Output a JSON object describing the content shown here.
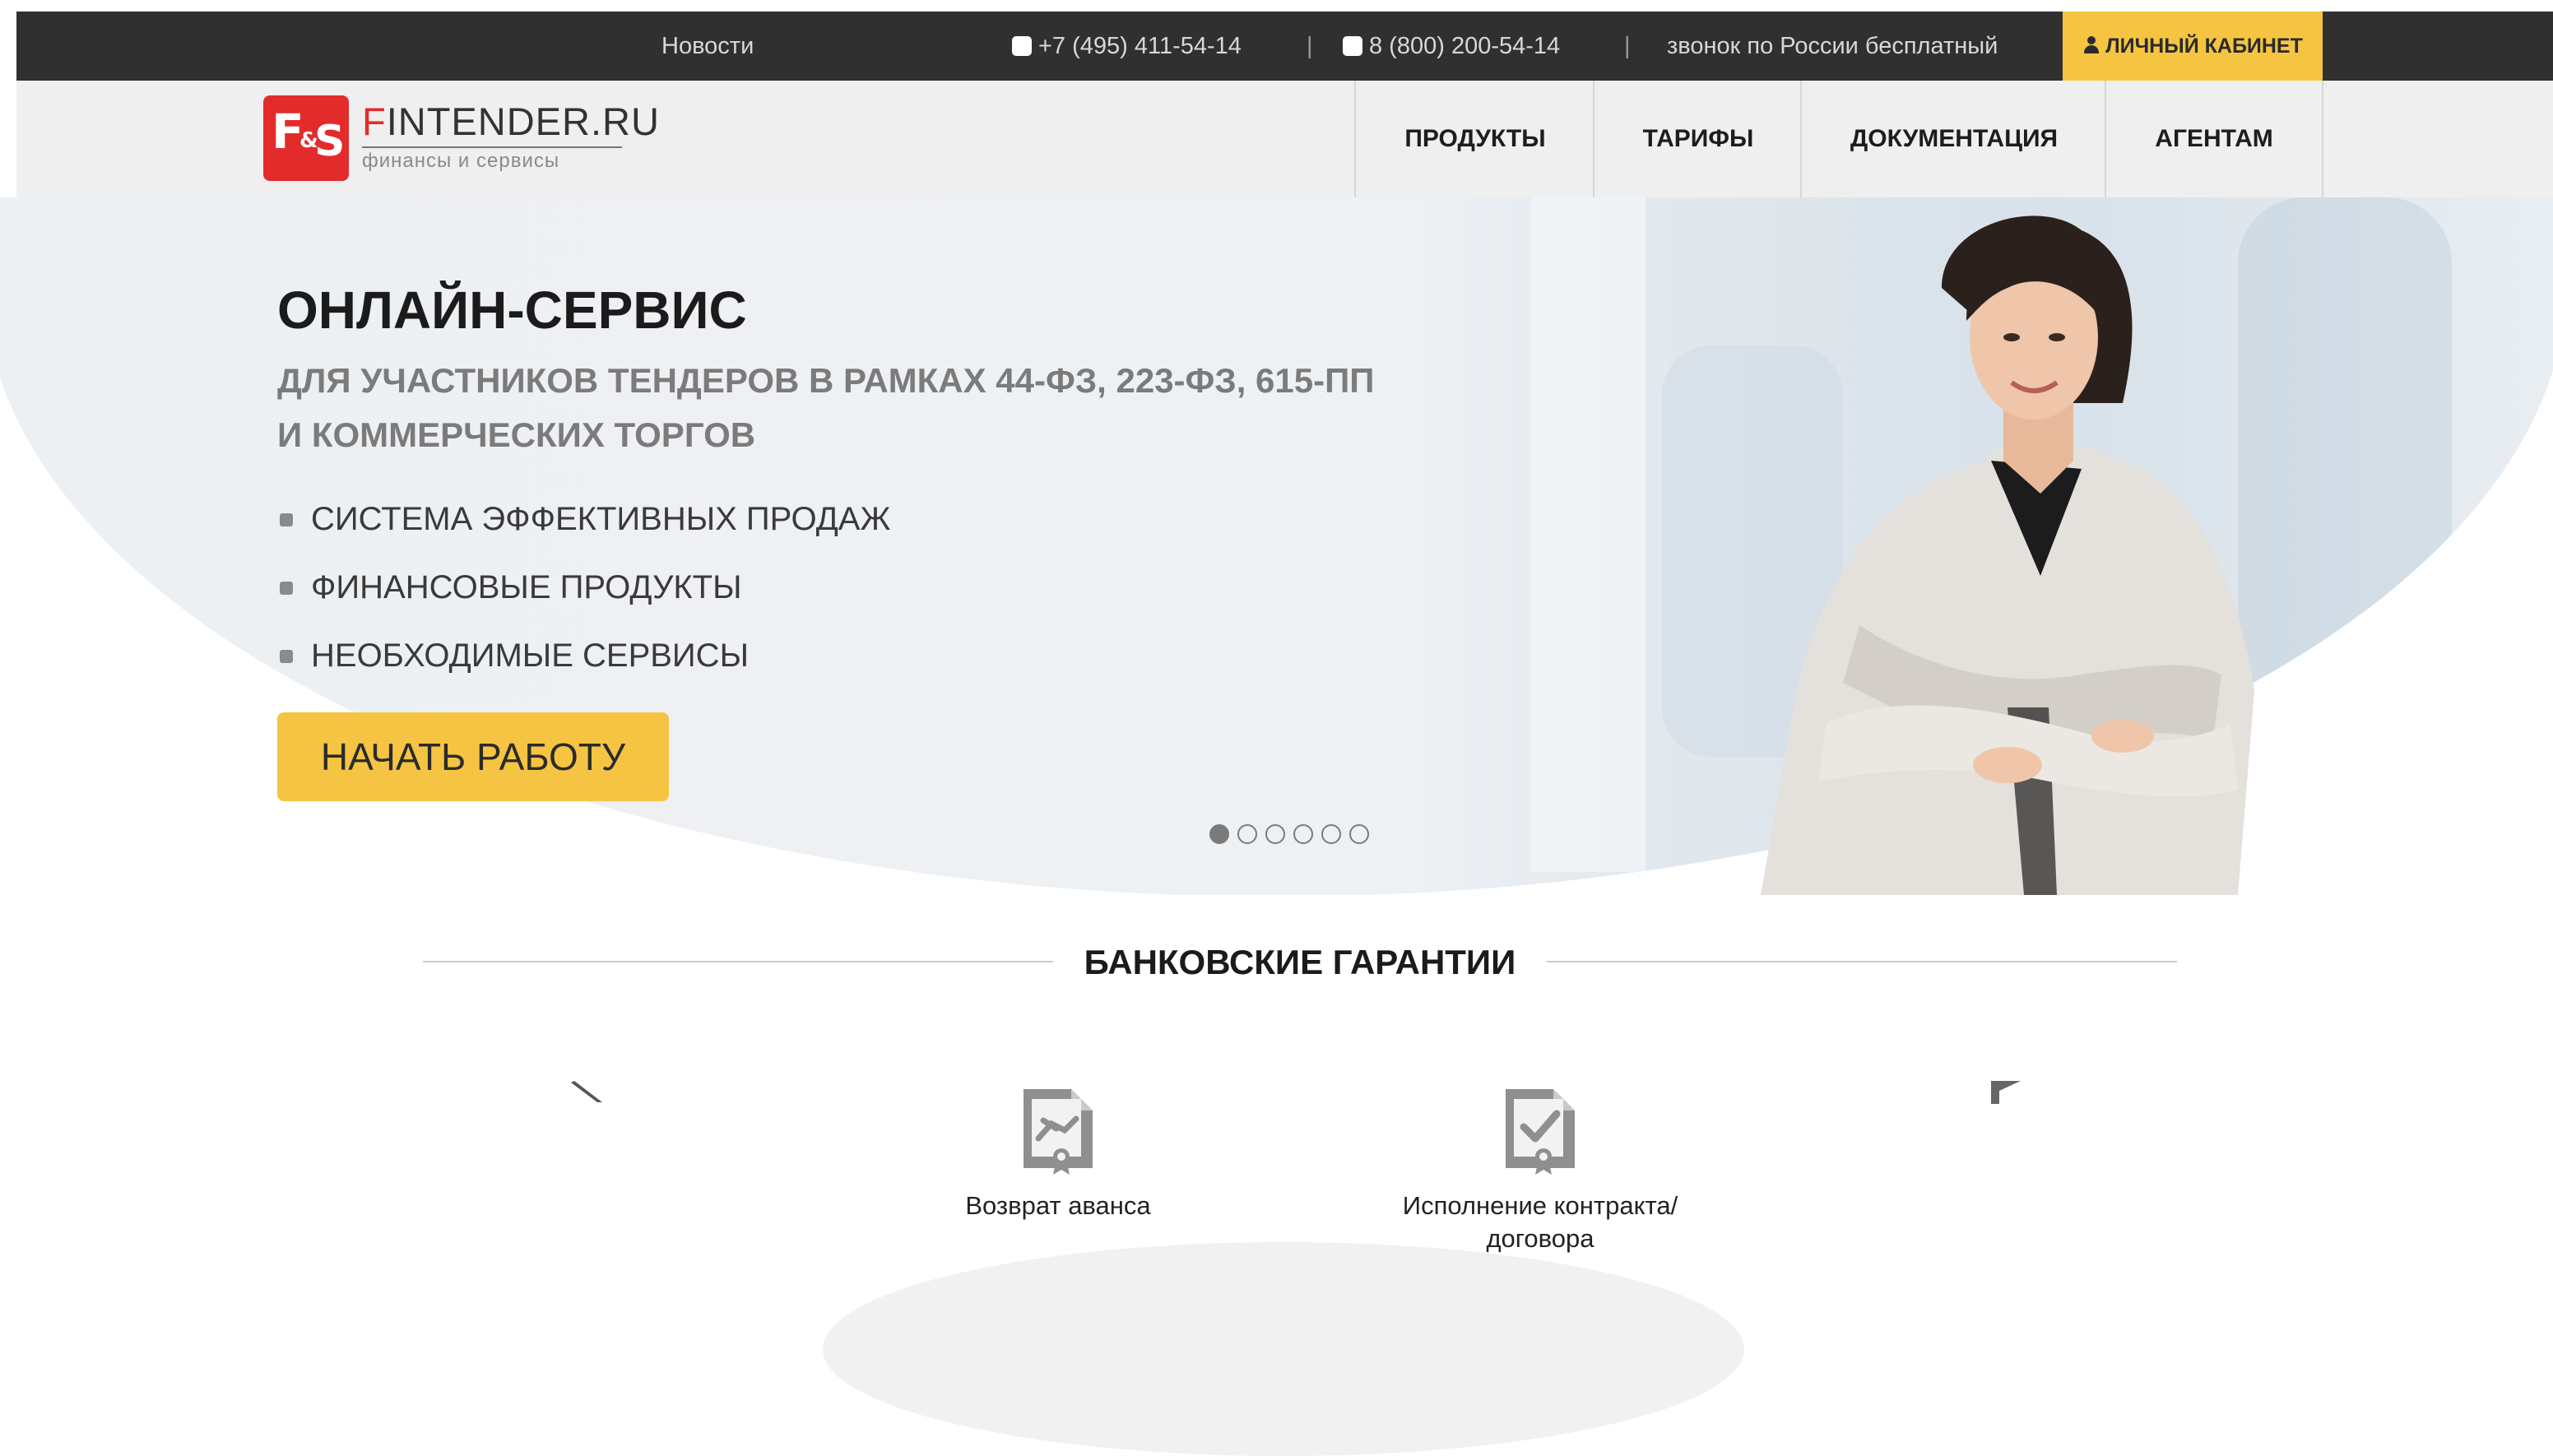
{
  "topbar": {
    "news": "Новости",
    "phone1": "+7 (495) 411-54-14",
    "separator": "|",
    "phone2": "8 (800) 200-54-14",
    "free_call": "звонок по России бесплатный",
    "cabinet": "ЛИЧНЫЙ КАБИНЕТ"
  },
  "logo": {
    "first_letter": "F",
    "rest": "INTENDER.RU",
    "subtitle": "финансы и сервисы",
    "mark_text": "F&S"
  },
  "nav": {
    "items": [
      {
        "label": "ПРОДУКТЫ"
      },
      {
        "label": "ТАРИФЫ"
      },
      {
        "label": "ДОКУМЕНТАЦИЯ"
      },
      {
        "label": "АГЕНТАМ"
      }
    ]
  },
  "hero": {
    "title": "ОНЛАЙН-СЕРВИС",
    "subtitle_line1": "ДЛЯ УЧАСТНИКОВ ТЕНДЕРОВ В РАМКАХ 44-ФЗ, 223-ФЗ, 615-ПП",
    "subtitle_line2": "И КОММЕРЧЕСКИХ ТОРГОВ",
    "features": [
      "СИСТЕМА ЭФФЕКТИВНЫХ ПРОДАЖ",
      "ФИНАНСОВЫЕ ПРОДУКТЫ",
      "НЕОБХОДИМЫЕ СЕРВИСЫ"
    ],
    "cta": "НАЧАТЬ РАБОТУ",
    "slides_count": 6,
    "active_slide": 1
  },
  "section": {
    "title": "БАНКОВСКИЕ ГАРАНТИИ",
    "cards": [
      {
        "label": "Возврат аванса",
        "icon": "document-handshake-icon"
      },
      {
        "label_line1": "Исполнение контракта/",
        "label_line2": "договора",
        "icon": "document-checkmark-icon"
      }
    ]
  },
  "colors": {
    "accent": "#f5c542",
    "brand_red": "#e32b2b",
    "topbar_bg": "#303030",
    "navbar_bg": "#efefef"
  }
}
